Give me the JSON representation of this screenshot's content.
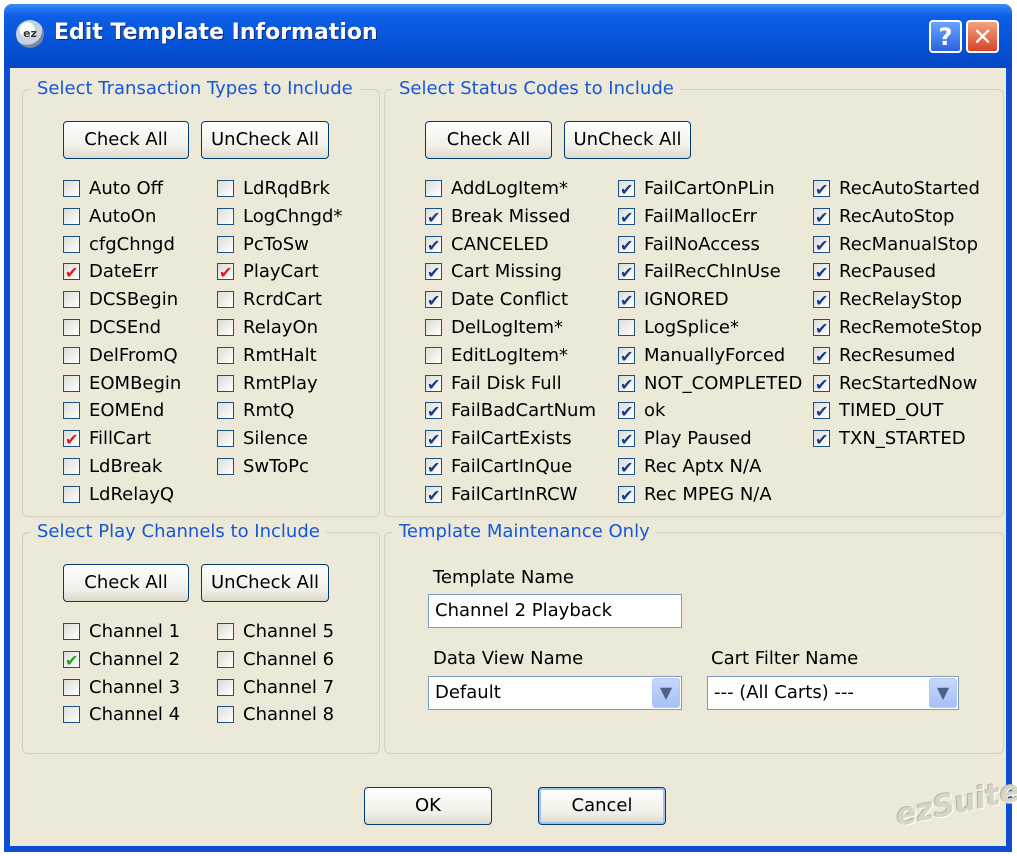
{
  "window": {
    "title": "Edit Template Information",
    "icon_text": "ez",
    "help_label": "?",
    "close_label": "✕"
  },
  "colors": {
    "title_bar": "#0653d8",
    "group_label": "#1657d6",
    "check_navy": "#1a3a8a",
    "check_red": "#e01818",
    "check_green": "#21a121",
    "face": "#ece9d8"
  },
  "transaction_types": {
    "legend": "Select Transaction Types to Include",
    "check_all_label": "Check All",
    "uncheck_all_label": "UnCheck All",
    "items": [
      {
        "label": "Auto Off",
        "checked": false
      },
      {
        "label": "AutoOn",
        "checked": false
      },
      {
        "label": "cfgChngd",
        "checked": false
      },
      {
        "label": "DateErr",
        "checked": true
      },
      {
        "label": "DCSBegin",
        "checked": false
      },
      {
        "label": "DCSEnd",
        "checked": false
      },
      {
        "label": "DelFromQ",
        "checked": false
      },
      {
        "label": "EOMBegin",
        "checked": false
      },
      {
        "label": "EOMEnd",
        "checked": false
      },
      {
        "label": "FillCart",
        "checked": true
      },
      {
        "label": "LdBreak",
        "checked": false
      },
      {
        "label": "LdRelayQ",
        "checked": false
      },
      {
        "label": "LdRqdBrk",
        "checked": false
      },
      {
        "label": "LogChngd*",
        "checked": false
      },
      {
        "label": "PcToSw",
        "checked": false
      },
      {
        "label": "PlayCart",
        "checked": true
      },
      {
        "label": "RcrdCart",
        "checked": false
      },
      {
        "label": "RelayOn",
        "checked": false
      },
      {
        "label": "RmtHalt",
        "checked": false
      },
      {
        "label": "RmtPlay",
        "checked": false
      },
      {
        "label": "RmtQ",
        "checked": false
      },
      {
        "label": "Silence",
        "checked": false
      },
      {
        "label": "SwToPc",
        "checked": false
      }
    ]
  },
  "status_codes": {
    "legend": "Select Status Codes to Include",
    "check_all_label": "Check All",
    "uncheck_all_label": "UnCheck All",
    "items": [
      {
        "label": "AddLogItem*",
        "checked": false
      },
      {
        "label": "Break Missed",
        "checked": true
      },
      {
        "label": "CANCELED",
        "checked": true
      },
      {
        "label": "Cart Missing",
        "checked": true
      },
      {
        "label": "Date Conflict",
        "checked": true
      },
      {
        "label": "DelLogItem*",
        "checked": false
      },
      {
        "label": "EditLogItem*",
        "checked": false
      },
      {
        "label": "Fail Disk Full",
        "checked": true
      },
      {
        "label": "FailBadCartNum",
        "checked": true
      },
      {
        "label": "FailCartExists",
        "checked": true
      },
      {
        "label": "FailCartInQue",
        "checked": true
      },
      {
        "label": "FailCartInRCW",
        "checked": true
      },
      {
        "label": "FailCartOnPLin",
        "checked": true
      },
      {
        "label": "FailMallocErr",
        "checked": true
      },
      {
        "label": "FailNoAccess",
        "checked": true
      },
      {
        "label": "FailRecChInUse",
        "checked": true
      },
      {
        "label": "IGNORED",
        "checked": true
      },
      {
        "label": "LogSplice*",
        "checked": false
      },
      {
        "label": "ManuallyForced",
        "checked": true
      },
      {
        "label": "NOT_COMPLETED",
        "checked": true
      },
      {
        "label": "ok",
        "checked": true
      },
      {
        "label": "Play Paused",
        "checked": true
      },
      {
        "label": "Rec Aptx N/A",
        "checked": true
      },
      {
        "label": "Rec MPEG N/A",
        "checked": true
      },
      {
        "label": "RecAutoStarted",
        "checked": true
      },
      {
        "label": "RecAutoStop",
        "checked": true
      },
      {
        "label": "RecManualStop",
        "checked": true
      },
      {
        "label": "RecPaused",
        "checked": true
      },
      {
        "label": "RecRelayStop",
        "checked": true
      },
      {
        "label": "RecRemoteStop",
        "checked": true
      },
      {
        "label": "RecResumed",
        "checked": true
      },
      {
        "label": "RecStartedNow",
        "checked": true
      },
      {
        "label": "TIMED_OUT",
        "checked": true
      },
      {
        "label": "TXN_STARTED",
        "checked": true
      }
    ]
  },
  "play_channels": {
    "legend": "Select Play Channels to Include",
    "check_all_label": "Check All",
    "uncheck_all_label": "UnCheck All",
    "items": [
      {
        "label": "Channel 1",
        "checked": false
      },
      {
        "label": "Channel 2",
        "checked": true
      },
      {
        "label": "Channel 3",
        "checked": false
      },
      {
        "label": "Channel 4",
        "checked": false
      },
      {
        "label": "Channel 5",
        "checked": false
      },
      {
        "label": "Channel 6",
        "checked": false
      },
      {
        "label": "Channel 7",
        "checked": false
      },
      {
        "label": "Channel 8",
        "checked": false
      }
    ]
  },
  "maintenance": {
    "legend": "Template Maintenance Only",
    "template_name_label": "Template Name",
    "template_name_value": "Channel 2 Playback",
    "data_view_label": "Data View Name",
    "data_view_value": "Default",
    "cart_filter_label": "Cart Filter Name",
    "cart_filter_value": "--- (All Carts) ---"
  },
  "footer": {
    "ok_label": "OK",
    "cancel_label": "Cancel",
    "logo_text": "ezSuite"
  }
}
